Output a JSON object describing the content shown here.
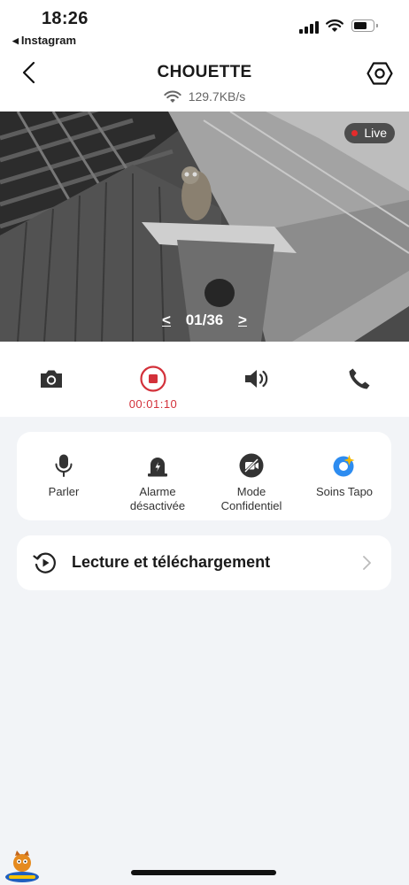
{
  "status_bar": {
    "time": "18:26",
    "back_app": "Instagram",
    "battery_percent": 60
  },
  "header": {
    "title": "CHOUETTE",
    "speed": "129.7KB/s"
  },
  "video": {
    "live_label": "Live",
    "page_counter": "01/36",
    "prev_label": "<",
    "next_label": ">"
  },
  "controls": {
    "recording_time": "00:01:10"
  },
  "actions": [
    {
      "label": "Parler",
      "icon": "microphone-icon"
    },
    {
      "label": "Alarme\ndésactivée",
      "icon": "siren-icon"
    },
    {
      "label": "Mode\nConfidentiel",
      "icon": "camera-off-icon"
    },
    {
      "label": "Soins Tapo",
      "icon": "tapo-care-icon"
    }
  ],
  "playback": {
    "label": "Lecture et téléchargement"
  },
  "colors": {
    "accent_red": "#d3313a",
    "live_dot": "#e52b2b",
    "tapo_blue": "#2d8cf0",
    "tapo_yellow": "#f5b800",
    "background": "#f2f4f7"
  }
}
